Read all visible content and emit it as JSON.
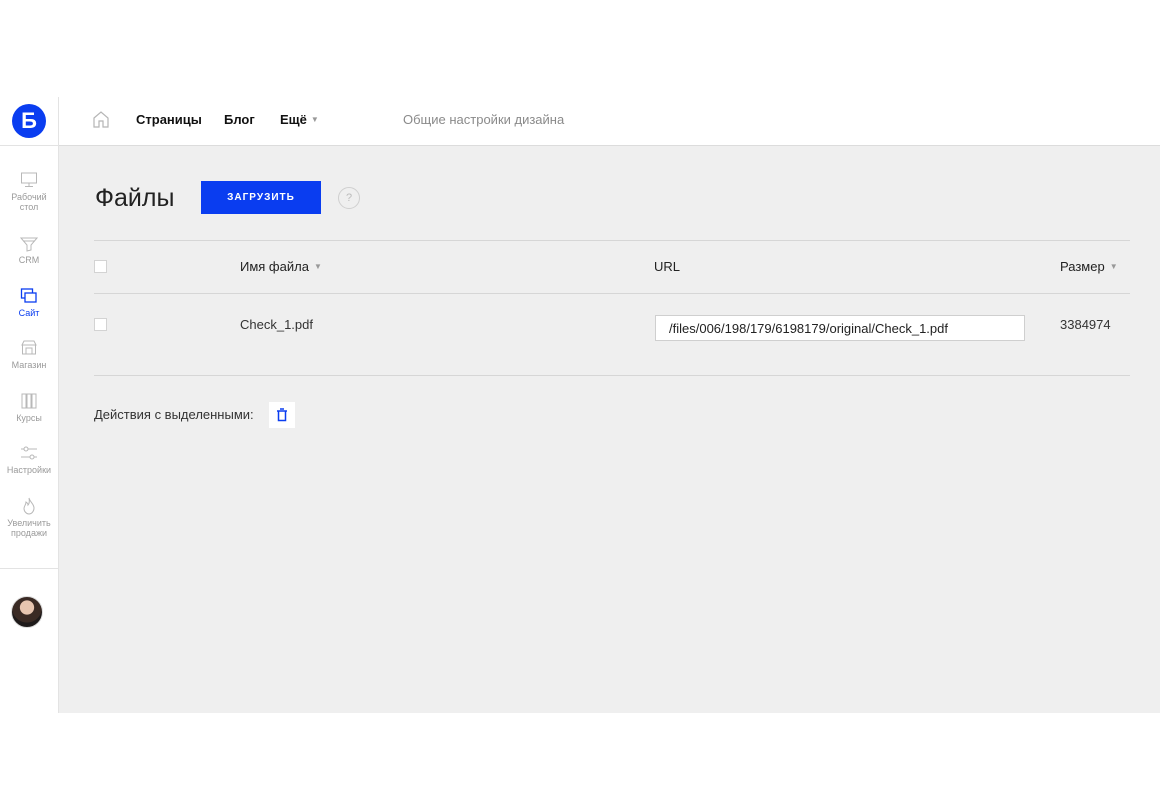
{
  "brand": {
    "logo_letter": "Б",
    "accent": "#0a3df0"
  },
  "sidebar": {
    "items": [
      {
        "label": "Рабочий стол",
        "icon": "monitor-icon",
        "active": false
      },
      {
        "label": "CRM",
        "icon": "funnel-icon",
        "active": false
      },
      {
        "label": "Сайт",
        "icon": "site-icon",
        "active": true
      },
      {
        "label": "Магазин",
        "icon": "store-icon",
        "active": false
      },
      {
        "label": "Курсы",
        "icon": "courses-icon",
        "active": false
      },
      {
        "label": "Настройки",
        "icon": "settings-icon",
        "active": false
      },
      {
        "label": "Увеличить продажи",
        "icon": "fire-icon",
        "active": false
      }
    ]
  },
  "topnav": {
    "pages": "Страницы",
    "blog": "Блог",
    "more": "Ещё",
    "design": "Общие настройки дизайна"
  },
  "page": {
    "title": "Файлы",
    "upload_label": "ЗАГРУЗИТЬ",
    "help": "?"
  },
  "table": {
    "headers": {
      "name": "Имя файла",
      "url": "URL",
      "size": "Размер"
    },
    "rows": [
      {
        "name": "Check_1.pdf",
        "url": "/files/006/198/179/6198179/original/Check_1.pdf",
        "size": "3384974"
      }
    ]
  },
  "bulk": {
    "label": "Действия с выделенными:"
  }
}
